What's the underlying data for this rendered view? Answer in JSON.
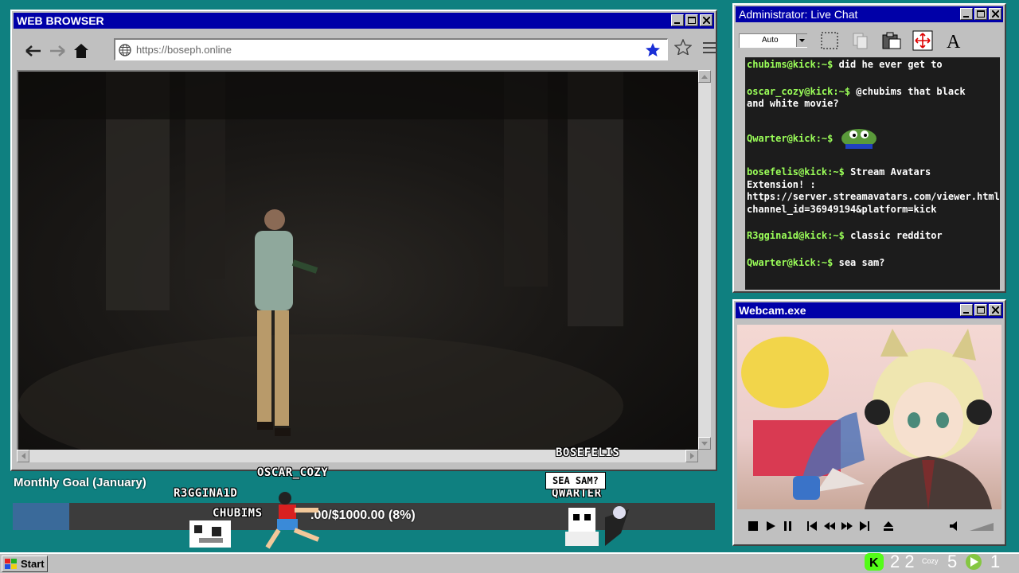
{
  "browser": {
    "title": "WEB BROWSER",
    "url": "https://boseph.online"
  },
  "chat": {
    "title": "Administrator: Live Chat",
    "zoom_value": "Auto",
    "messages": [
      {
        "user": "chubims@kick:~$",
        "text": "did he ever get to"
      },
      {
        "user": "oscar_cozy@kick:~$",
        "text": "@chubims that black and white movie?"
      },
      {
        "user": "Qwarter@kick:~$",
        "text": "",
        "emote": "pepe-emote"
      },
      {
        "user": "bosefelis@kick:~$",
        "text": "Stream Avatars Extension! : https://server.streamavatars.com/viewer.html?channel_id=36949194&platform=kick"
      },
      {
        "user": "R3ggina1d@kick:~$",
        "text": "classic redditor"
      },
      {
        "user": "Qwarter@kick:~$",
        "text": "sea sam?"
      }
    ]
  },
  "webcam": {
    "title": "Webcam.exe"
  },
  "goal": {
    "label": "Monthly Goal (January)",
    "amount_text": ".00/$1000.00 (8%)",
    "progress_fraction": 0.08
  },
  "avatars": {
    "names": [
      "OSCAR_COZY",
      "R3GGINA1D",
      "CHUBIMS",
      "BOSEFELIS",
      "QWARTER"
    ],
    "bubble": "SEA SAM?"
  },
  "taskbar": {
    "start_label": "Start",
    "tray_a": "2 2",
    "tray_b": "5",
    "tray_c": "1",
    "tray_small": "Cozy"
  },
  "colors": {
    "desktop": "#0f8080",
    "titlebar": "#0000a8",
    "chat_user": "#9bff59",
    "goal_fill": "#3a6a9a"
  }
}
